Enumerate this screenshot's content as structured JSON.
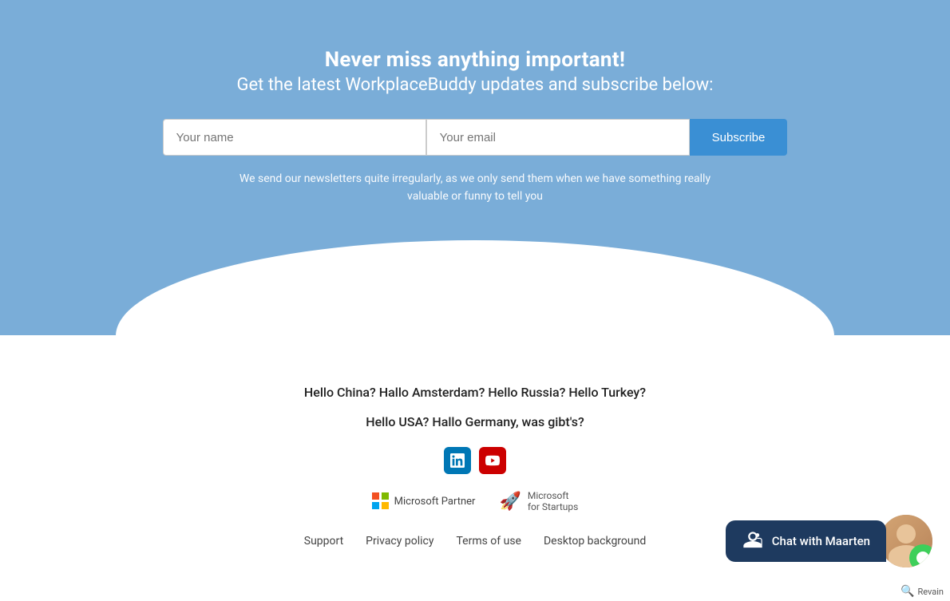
{
  "headline": {
    "line1": "Never miss anything important!",
    "line2": "Get the latest WorkplaceBuddy updates and subscribe below:"
  },
  "form": {
    "name_placeholder": "Your name",
    "email_placeholder": "Your email",
    "subscribe_label": "Subscribe"
  },
  "disclaimer": "We send our newsletters quite irregularly, as we only send them when we have something really valuable or funny to tell you",
  "greeting": {
    "line1": "Hello China? Hallo Amsterdam? Hello Russia? Hello Turkey?",
    "line2": "Hello USA? Hallo Germany, was gibt's?"
  },
  "partners": {
    "ms_partner_label": "Microsoft Partner",
    "ms_startup_label": "Microsoft\nfor Startups"
  },
  "footer": {
    "links": [
      {
        "label": "Support",
        "href": "#"
      },
      {
        "label": "Privacy policy",
        "href": "#"
      },
      {
        "label": "Terms of use",
        "href": "#"
      },
      {
        "label": "Desktop background",
        "href": "#"
      }
    ]
  },
  "chat": {
    "label": "Chat with Maarten"
  },
  "revain": {
    "label": "Revain"
  },
  "colors": {
    "blue_bg": "#7aadd8",
    "subscribe_btn": "#3a8fd4",
    "chat_bg": "#1e3a5f"
  }
}
